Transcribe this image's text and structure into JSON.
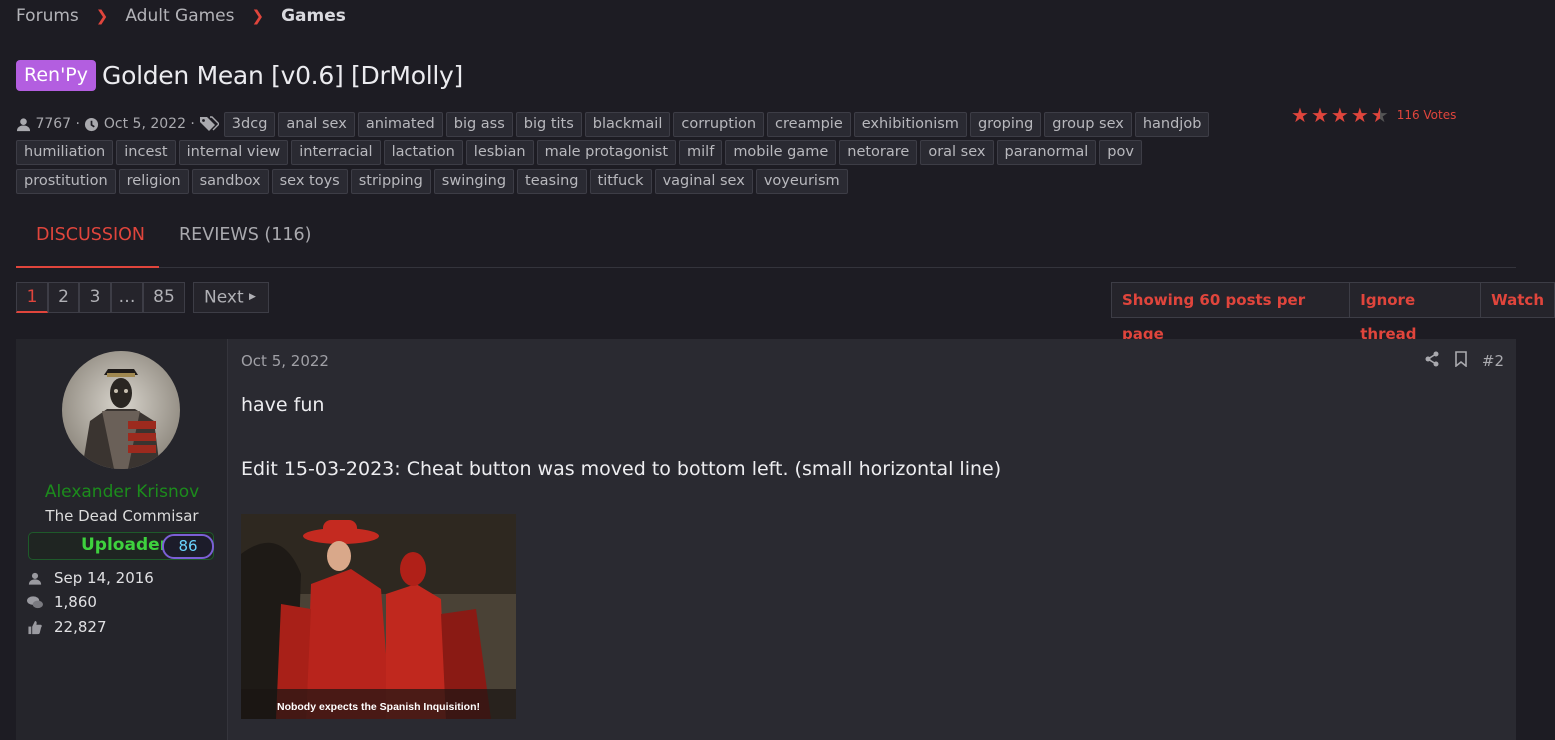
{
  "breadcrumb": {
    "items": [
      "Forums",
      "Adult Games",
      "Games"
    ]
  },
  "thread": {
    "prefix": "Ren'Py",
    "title": "Golden Mean [v0.6] [DrMolly]",
    "author_id": "7767 ·",
    "date": "Oct 5, 2022 ·",
    "tags": [
      "3dcg",
      "anal sex",
      "animated",
      "big ass",
      "big tits",
      "blackmail",
      "corruption",
      "creampie",
      "exhibitionism",
      "groping",
      "group sex",
      "handjob",
      "humiliation",
      "incest",
      "internal view",
      "interracial",
      "lactation",
      "lesbian",
      "male protagonist",
      "milf",
      "mobile game",
      "netorare",
      "oral sex",
      "paranormal",
      "pov",
      "prostitution",
      "religion",
      "sandbox",
      "sex toys",
      "stripping",
      "swinging",
      "teasing",
      "titfuck",
      "vaginal sex",
      "voyeurism"
    ],
    "rating": {
      "stars": 4.5,
      "votes": "116 Votes"
    }
  },
  "tabs": [
    {
      "label": "DISCUSSION"
    },
    {
      "label": "REVIEWS (116)"
    }
  ],
  "pagination": {
    "pages": [
      "1",
      "2",
      "3",
      "…",
      "85"
    ],
    "current": "1",
    "next": "Next"
  },
  "actions": {
    "posts_per_page": "Showing 60 posts per page",
    "ignore": "Ignore thread",
    "watch": "Watch"
  },
  "post": {
    "date": "Oct 5, 2022",
    "number": "#2",
    "user": {
      "name": "Alexander Krisnov",
      "title": "The Dead Commisar",
      "banner": "Uploader",
      "banner_num": "86",
      "joined": "Sep 14, 2016",
      "messages": "1,860",
      "reactions": "22,827"
    },
    "body_line1": "have fun",
    "body_line2": "Edit 15-03-2023: Cheat button was moved to bottom left. (small horizontal line)",
    "image_caption": "Nobody expects the Spanish Inquisition!"
  },
  "colors": {
    "accent": "#e0453c",
    "prefix": "#b35ee0",
    "username": "#1c8c1c",
    "background": "#1d1c23"
  }
}
